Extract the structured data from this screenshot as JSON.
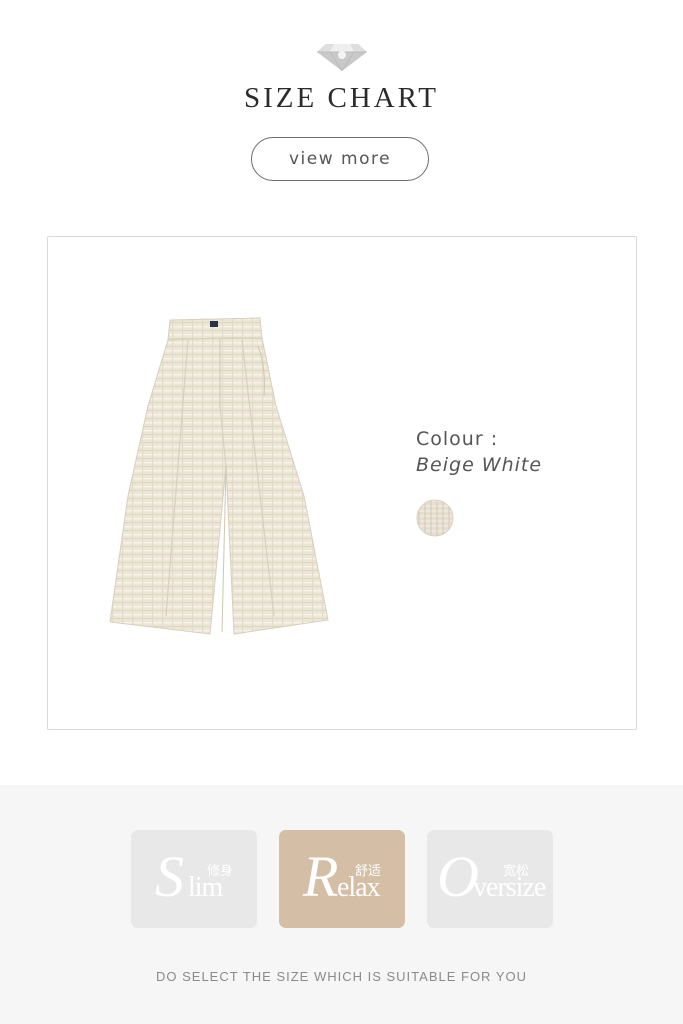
{
  "header": {
    "icon": "diamond-icon",
    "title": "SIZE CHART",
    "view_more_label": "view more"
  },
  "product": {
    "image": "wide-leg-pants",
    "colour_label": "Colour :",
    "colour_value": "Beige White",
    "swatch_color": "#e6dfd0"
  },
  "fits": [
    {
      "big": "S",
      "rest": "lim",
      "cn": "修身",
      "color": "#e8e8e8",
      "selected": false
    },
    {
      "big": "R",
      "rest": "elax",
      "cn": "舒适",
      "color": "#d4bea6",
      "selected": true
    },
    {
      "big": "O",
      "rest": "versize",
      "cn": "宽松",
      "color": "#e8e8e8",
      "selected": false
    }
  ],
  "footer_note": "DO SELECT THE SIZE WHICH IS SUITABLE FOR YOU"
}
